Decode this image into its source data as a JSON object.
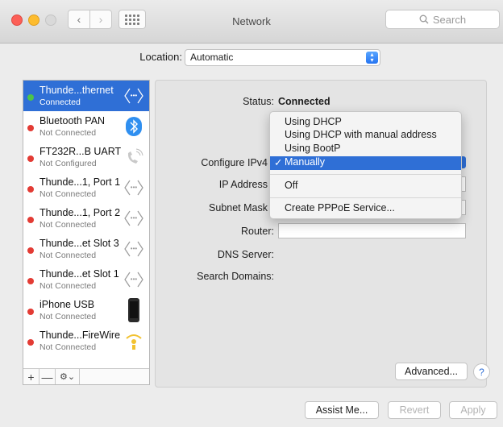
{
  "window": {
    "title": "Network"
  },
  "search": {
    "placeholder": "Search",
    "icon": "magnifier-icon"
  },
  "location": {
    "label": "Location:",
    "value": "Automatic"
  },
  "services": [
    {
      "name": "Thunde...thernet",
      "status": "Connected",
      "selected": true,
      "icon": "ethernet-arrows-icon"
    },
    {
      "name": "Bluetooth PAN",
      "status": "Not Connected",
      "icon": "bluetooth-icon"
    },
    {
      "name": "FT232R...B UART",
      "status": "Not Configured",
      "icon": "phone-handset-icon"
    },
    {
      "name": "Thunde...1, Port 1",
      "status": "Not Connected",
      "icon": "ethernet-arrows-icon"
    },
    {
      "name": "Thunde...1, Port 2",
      "status": "Not Connected",
      "icon": "ethernet-arrows-icon"
    },
    {
      "name": "Thunde...et Slot 3",
      "status": "Not Connected",
      "icon": "ethernet-arrows-icon"
    },
    {
      "name": "Thunde...et Slot 1",
      "status": "Not Connected",
      "icon": "ethernet-arrows-icon"
    },
    {
      "name": "iPhone USB",
      "status": "Not Connected",
      "icon": "iphone-icon"
    },
    {
      "name": "Thunde...FireWire",
      "status": "Not Connected",
      "icon": "firewire-icon"
    }
  ],
  "sidebar_tools": {
    "add": "+",
    "remove": "—",
    "gear": "⚙⌄"
  },
  "details": {
    "status_label": "Status:",
    "status_value": "Connected",
    "configure_label": "Configure IPv4",
    "ip_label": "IP Address",
    "subnet_label": "Subnet Mask",
    "router_label": "Router:",
    "dns_label": "DNS Server:",
    "search_domains_label": "Search Domains:"
  },
  "menu": {
    "items": [
      {
        "label": "Using DHCP"
      },
      {
        "label": "Using DHCP with manual address"
      },
      {
        "label": "Using BootP"
      },
      {
        "label": "Manually",
        "selected": true,
        "check": "✓"
      },
      {
        "label": "Off"
      },
      {
        "label": "Create PPPoE Service..."
      }
    ]
  },
  "buttons": {
    "advanced": "Advanced...",
    "help": "?",
    "assist": "Assist Me...",
    "revert": "Revert",
    "apply": "Apply"
  },
  "colors": {
    "selection": "#2f6fd6",
    "connected": "#4cc44a",
    "disconnected": "#e33b34"
  }
}
